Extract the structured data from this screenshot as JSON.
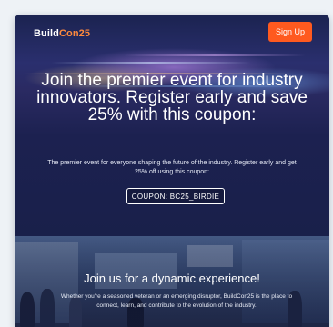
{
  "header": {
    "logo_main": "Build",
    "logo_accent": "Con25",
    "signup_label": "Sign Up"
  },
  "hero": {
    "headline": "Join the premier event for industry innovators. Register early and save 25% with this coupon:",
    "subtext": "The premier event for everyone shaping the future of the industry. Register early and get 25% off using this coupon:",
    "coupon_label": "COUPON: BC25_BIRDIE"
  },
  "experience": {
    "title": "Join us for a dynamic experience!",
    "text": "Whether you're a seasoned veteran or an emerging disruptor, BuildCon25 is the place to connect, learn, and contribute to the evolution of the industry."
  },
  "colors": {
    "accent": "#ff5a1f",
    "logo_accent": "#ff8a3d",
    "hero_bg": "#1c2150",
    "page_bg": "#eef2f6"
  }
}
